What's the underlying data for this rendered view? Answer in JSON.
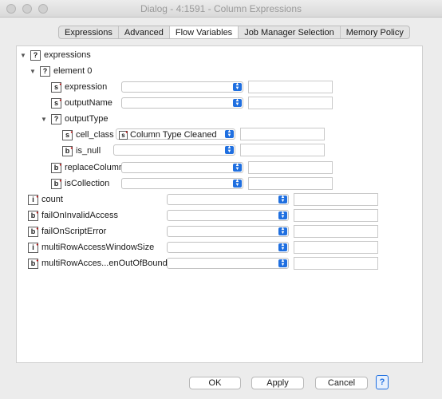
{
  "window": {
    "title": "Dialog - 4:1591 - Column Expressions"
  },
  "tabs": [
    {
      "label": "Expressions"
    },
    {
      "label": "Advanced"
    },
    {
      "label": "Flow Variables"
    },
    {
      "label": "Job Manager Selection"
    },
    {
      "label": "Memory Policy"
    }
  ],
  "active_tab": "Flow Variables",
  "tree": {
    "expressions": {
      "badge": "?",
      "label": "expressions",
      "expanded": true
    },
    "element0": {
      "badge": "?",
      "label": "element 0",
      "expanded": true
    },
    "expression": {
      "badge": "s",
      "label": "expression",
      "value": ""
    },
    "outputName": {
      "badge": "s",
      "label": "outputName",
      "value": ""
    },
    "outputType": {
      "badge": "?",
      "label": "outputType",
      "expanded": true
    },
    "cell_class": {
      "badge": "s",
      "label": "cell_class",
      "value_badge": "s",
      "value": "Column Type Cleaned"
    },
    "is_null": {
      "badge": "b",
      "label": "is_null",
      "value": ""
    },
    "replaceColumn": {
      "badge": "b",
      "label": "replaceColumn",
      "value": ""
    },
    "isCollection": {
      "badge": "b",
      "label": "isCollection",
      "value": ""
    },
    "count": {
      "badge": "i",
      "label": "count",
      "value": ""
    },
    "failOnInvalidAccess": {
      "badge": "b",
      "label": "failOnInvalidAccess",
      "value": ""
    },
    "failOnScriptError": {
      "badge": "b",
      "label": "failOnScriptError",
      "value": ""
    },
    "multiRowAccessWindowSize": {
      "badge": "i",
      "label": "multiRowAccessWindowSize",
      "value": ""
    },
    "multiRowAccessOutOfBounds": {
      "badge": "b",
      "label": "multiRowAcces...enOutOfBounds",
      "value": ""
    }
  },
  "buttons": {
    "ok": "OK",
    "apply": "Apply",
    "cancel": "Cancel",
    "help": "?"
  },
  "colors": {
    "accent": "#1f6fe0",
    "required_marker": "#c00000"
  }
}
